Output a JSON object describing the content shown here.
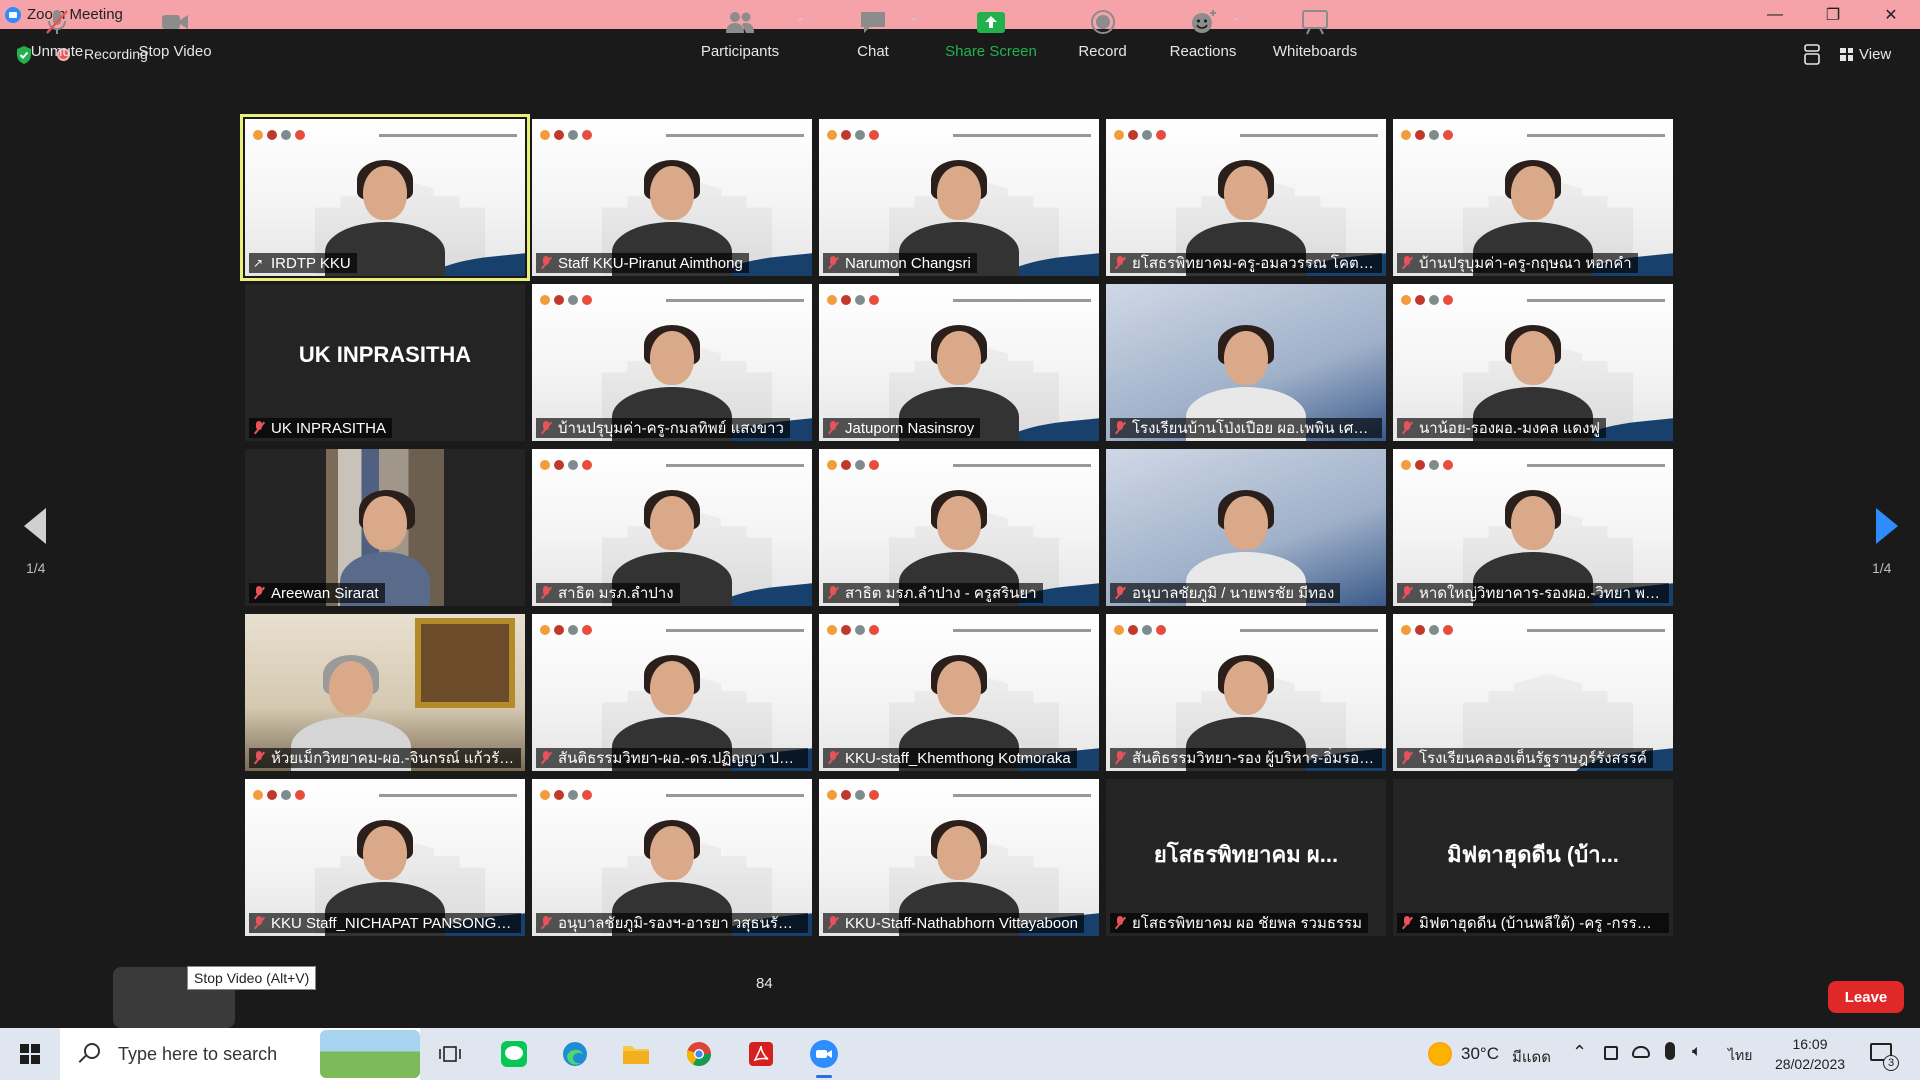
{
  "window": {
    "title": "Zoom Meeting",
    "controls": [
      "minimize",
      "restore",
      "close"
    ]
  },
  "topbar": {
    "recording_label": "Recording",
    "view_label": "View"
  },
  "gallery": {
    "page_indicator_left": "1/4",
    "page_indicator_right": "1/4",
    "tiles": [
      {
        "name": "IRDTP KKU",
        "type": "video",
        "active": true,
        "pinned": true
      },
      {
        "name": "Staff KKU-Piranut Aimthong",
        "type": "video"
      },
      {
        "name": "Narumon Changsri",
        "type": "video"
      },
      {
        "name": "ยโสธรพิทยาคม-ครู-อมลวรรณ โคตรพันธ์",
        "type": "video"
      },
      {
        "name": "บ้านปรุบุมค่า-ครู-กฤษณา หอกคำ",
        "type": "video"
      },
      {
        "name": "UK INPRASITHA",
        "type": "avatar",
        "big_name": "UK INPRASITHA"
      },
      {
        "name": "บ้านปรุบุมค่า-ครู-กมลทิพย์ แสงขาว",
        "type": "video"
      },
      {
        "name": "Jatuporn Nasinsroy",
        "type": "video"
      },
      {
        "name": "โรงเรียนบ้านโป่งเปือย ผอ.เพพิน เศรษฐบดี",
        "type": "room"
      },
      {
        "name": "นาน้อย-รองผอ.-มงคล แดงฟู",
        "type": "video"
      },
      {
        "name": "Areewan Sirarat",
        "type": "shelf"
      },
      {
        "name": "สาธิต มรภ.ลำปาง",
        "type": "video"
      },
      {
        "name": "สาธิต มรภ.ลำปาง - ครูสรินยา",
        "type": "video"
      },
      {
        "name": "อนุบาลชัยภูมิ / นายพรชัย มีทอง",
        "type": "room"
      },
      {
        "name": "หาดใหญ่วิทยาคาร-รองผอ.-วิทยา พยาบาม",
        "type": "video"
      },
      {
        "name": "ห้วยเม็กวิทยาคม-ผอ.-จินกรณ์ แก้วรักษา",
        "type": "office"
      },
      {
        "name": "สันติธรรมวิทยา-ผอ.-ดร.ปฏิญญา ประพฤ...",
        "type": "video"
      },
      {
        "name": "KKU-staff_Khemthong Kotmoraka",
        "type": "video"
      },
      {
        "name": "สันติธรรมวิทยา-รอง ผู้บริหาร-อิ่มรอน สะ...",
        "type": "video"
      },
      {
        "name": "โรงเรียนคลองเต็นรัฐราษฎร์รังสรรค์",
        "type": "video",
        "empty": true
      },
      {
        "name": "KKU Staff_NICHAPAT PANSONGN...",
        "type": "video"
      },
      {
        "name": "อนุบาลชัยภูมิ-รองฯ-อารยา วสุธนรัตน์ส...",
        "type": "video"
      },
      {
        "name": "KKU-Staff-Nathabhorn Vittayaboon",
        "type": "video"
      },
      {
        "name": "ยโสธรพิทยาคม ผอ ชัยพล รวมธรรม",
        "type": "avatar",
        "big_name": "ยโสธรพิทยาคม ผ..."
      },
      {
        "name": "มิฟตาฮุดดีน (บ้านพลีใต้) -ครู -กรรณิกา...",
        "type": "avatar",
        "big_name": "มิฟตาฮุดดีน (บ้า..."
      }
    ]
  },
  "toolbar": {
    "unmute": "Unmute",
    "stop_video": "Stop Video",
    "tooltip": "Stop Video (Alt+V)",
    "participants": "Participants",
    "participant_count": "84",
    "chat": "Chat",
    "share_screen": "Share Screen",
    "record": "Record",
    "reactions": "Reactions",
    "whiteboards": "Whiteboards",
    "leave": "Leave"
  },
  "taskbar": {
    "search_placeholder": "Type here to search",
    "weather": "30°C",
    "weather_desc": "มีแดด",
    "language": "ไทย",
    "time": "16:09",
    "date": "28/02/2023",
    "notification_count": "3"
  },
  "colors": {
    "titlebar": "#f5a3a8",
    "accent_blue": "#2d8cff",
    "leave_red": "#e02828",
    "share_green": "#22b14c",
    "muted_red": "#e8535b"
  }
}
